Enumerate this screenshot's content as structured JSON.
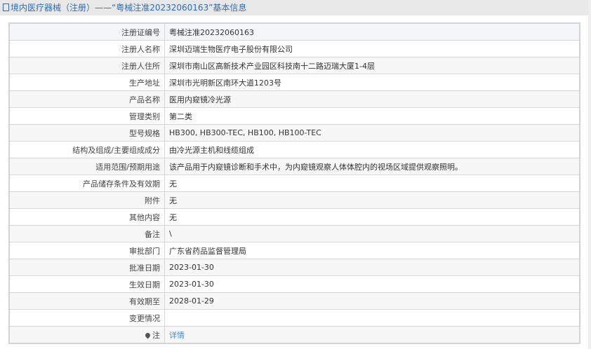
{
  "header": {
    "title": "境内医疗器械（注册）——“粤械注准20232060163”基本信息"
  },
  "rows": [
    {
      "label": "注册证编号",
      "value": "粤械注准20232060163"
    },
    {
      "label": "注册人名称",
      "value": "深圳迈瑞生物医疗电子股份有限公司"
    },
    {
      "label": "注册人住所",
      "value": "深圳市南山区高新技术产业园区科技南十二路迈瑞大厦1-4层"
    },
    {
      "label": "生产地址",
      "value": "深圳市光明新区南环大道1203号"
    },
    {
      "label": "产品名称",
      "value": "医用内窥镜冷光源"
    },
    {
      "label": "管理类别",
      "value": "第二类"
    },
    {
      "label": "型号规格",
      "value": "HB300, HB300-TEC, HB100, HB100-TEC"
    },
    {
      "label": "结构及组成/主要组成成分",
      "value": "由冷光源主机和线缆组成"
    },
    {
      "label": "适用范围/预期用途",
      "value": "该产品用于内窥镜诊断和手术中，为内窥镜观察人体体腔内的视场区域提供观察照明。"
    },
    {
      "label": "产品储存条件及有效期",
      "value": "无"
    },
    {
      "label": "附件",
      "value": "无"
    },
    {
      "label": "其他内容",
      "value": "无"
    },
    {
      "label": "备注",
      "value": "\\"
    },
    {
      "label": "审批部门",
      "value": "广东省药品监督管理局"
    },
    {
      "label": "批准日期",
      "value": "2023-01-30"
    },
    {
      "label": "生效日期",
      "value": "2023-01-30"
    },
    {
      "label": "有效期至",
      "value": "2028-01-29"
    },
    {
      "label": "变更情况",
      "value": ""
    }
  ],
  "note": {
    "label": "注",
    "link": "详情"
  }
}
